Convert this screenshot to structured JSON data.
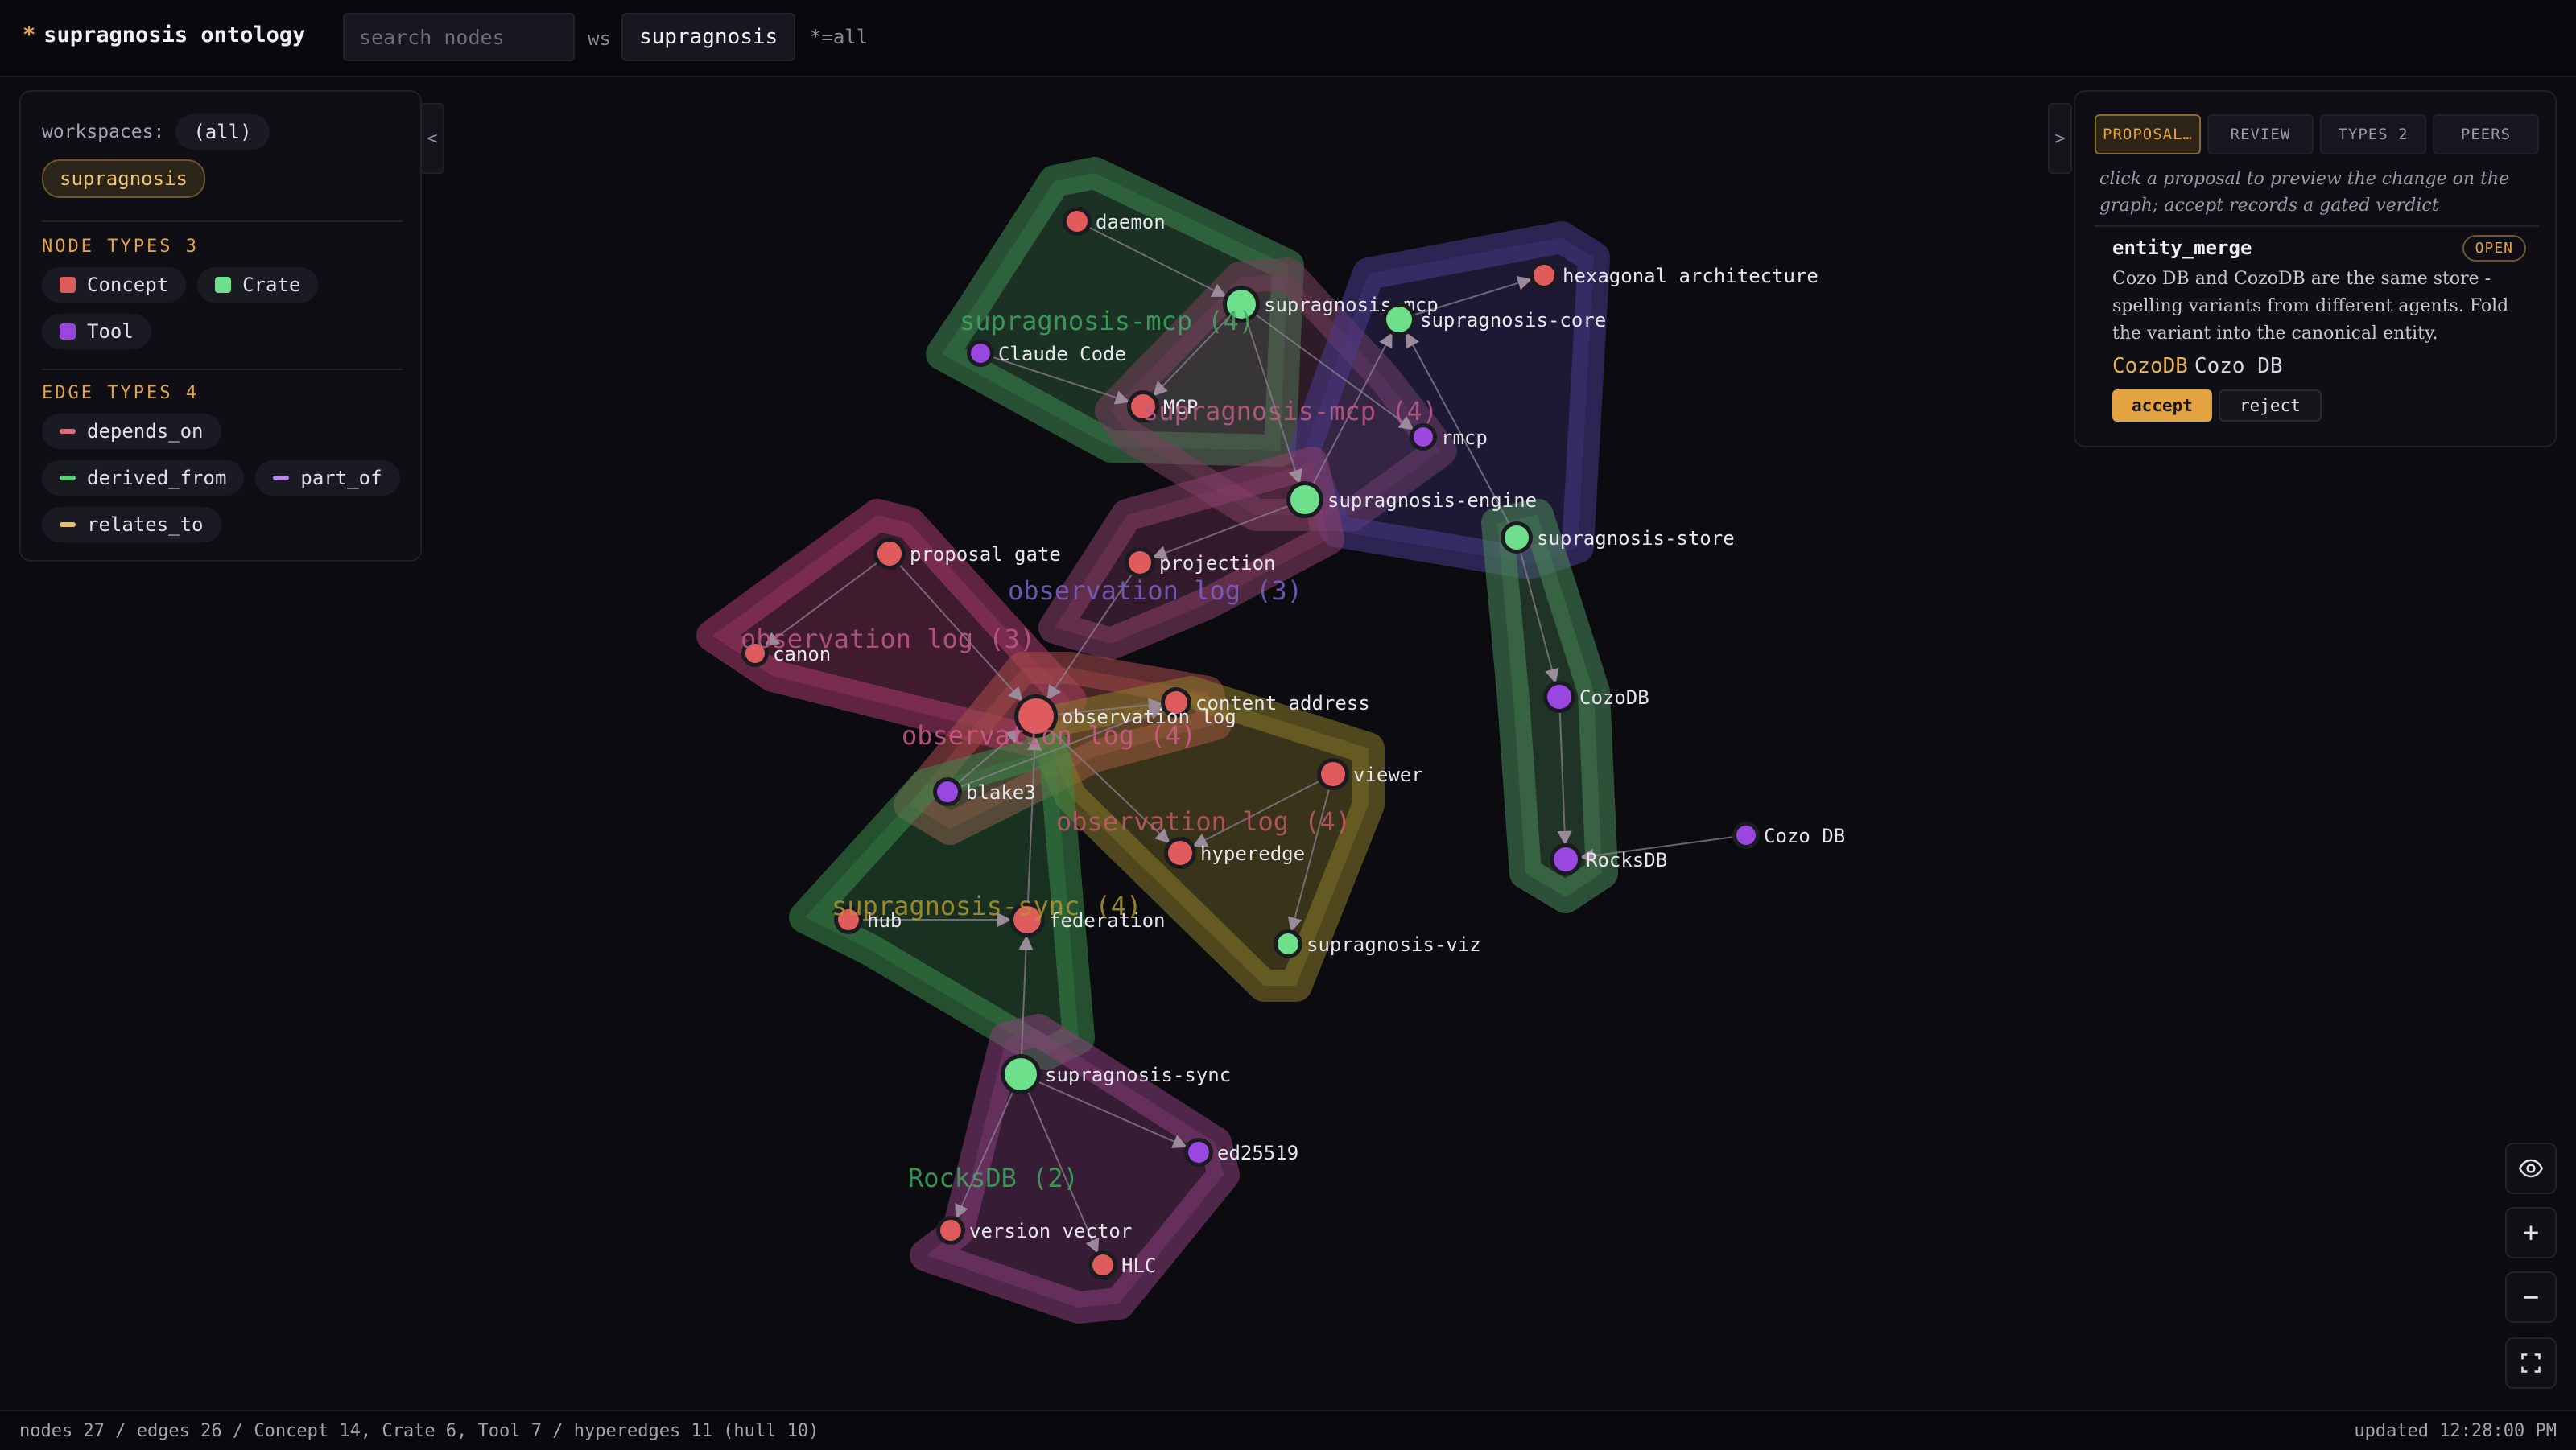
{
  "header": {
    "title": "supragnosis ontology",
    "title_mark": "*",
    "search_placeholder": "search nodes",
    "ws_label": "ws",
    "ws_value": "supragnosis",
    "ws_hint": "*=all"
  },
  "left_panel": {
    "collapse_glyph": "<",
    "workspaces_label": "workspaces:",
    "workspaces_all": "(all)",
    "workspace_active": "supragnosis",
    "node_types_title": "NODE TYPES 3",
    "node_types": [
      {
        "label": "Concept",
        "color": "#e05b5b"
      },
      {
        "label": "Crate",
        "color": "#6ee08c"
      },
      {
        "label": "Tool",
        "color": "#9a46e0"
      }
    ],
    "edge_types_title": "EDGE TYPES 4",
    "edge_types": [
      {
        "label": "depends_on",
        "color": "#e06a7a"
      },
      {
        "label": "derived_from",
        "color": "#56d07a"
      },
      {
        "label": "part_of",
        "color": "#b88ae8"
      },
      {
        "label": "relates_to",
        "color": "#e3c26a"
      }
    ]
  },
  "right_panel": {
    "collapse_glyph": ">",
    "tabs": [
      "PROPOSAL…",
      "REVIEW",
      "TYPES 2",
      "PEERS"
    ],
    "active_tab": 0,
    "hint": "click a proposal to preview the change on the graph; accept records a gated verdict",
    "proposal": {
      "kind": "entity_merge",
      "status": "OPEN",
      "description": "Cozo DB and CozoDB are the same store - spelling variants from different agents. Fold the variant into the canonical entity.",
      "canonical": "CozoDB",
      "variant": "Cozo DB",
      "accept_label": "accept",
      "reject_label": "reject"
    }
  },
  "graph": {
    "colors": {
      "Concept": "#e05b5b",
      "Crate": "#6ee08c",
      "Tool": "#9a46e0"
    },
    "nodes": [
      {
        "id": "daemon",
        "label": "daemon",
        "type": "Concept"
      },
      {
        "id": "supragnosis-mcp",
        "label": "supragnosis-mcp",
        "type": "Crate"
      },
      {
        "id": "hexagonal-architecture",
        "label": "hexagonal architecture",
        "type": "Concept"
      },
      {
        "id": "supragnosis-core",
        "label": "supragnosis-core",
        "type": "Crate"
      },
      {
        "id": "claude-code",
        "label": "Claude Code",
        "type": "Tool"
      },
      {
        "id": "mcp",
        "label": "MCP",
        "type": "Concept"
      },
      {
        "id": "rmcp",
        "label": "rmcp",
        "type": "Tool"
      },
      {
        "id": "supragnosis-engine",
        "label": "supragnosis-engine",
        "type": "Crate"
      },
      {
        "id": "supragnosis-store",
        "label": "supragnosis-store",
        "type": "Crate"
      },
      {
        "id": "proposal-gate",
        "label": "proposal gate",
        "type": "Concept"
      },
      {
        "id": "projection",
        "label": "projection",
        "type": "Concept"
      },
      {
        "id": "canon",
        "label": "canon",
        "type": "Concept"
      },
      {
        "id": "content-address",
        "label": "content address",
        "type": "Concept"
      },
      {
        "id": "observation-log",
        "label": "observation log",
        "type": "Concept"
      },
      {
        "id": "cozodb",
        "label": "CozoDB",
        "type": "Tool"
      },
      {
        "id": "viewer",
        "label": "viewer",
        "type": "Concept"
      },
      {
        "id": "blake3",
        "label": "blake3",
        "type": "Tool"
      },
      {
        "id": "hyperedge",
        "label": "hyperedge",
        "type": "Concept"
      },
      {
        "id": "rocksdb",
        "label": "RocksDB",
        "type": "Tool"
      },
      {
        "id": "cozo-db",
        "label": "Cozo DB",
        "type": "Tool"
      },
      {
        "id": "hub",
        "label": "hub",
        "type": "Concept"
      },
      {
        "id": "federation",
        "label": "federation",
        "type": "Concept"
      },
      {
        "id": "supragnosis-viz",
        "label": "supragnosis-viz",
        "type": "Crate"
      },
      {
        "id": "supragnosis-sync",
        "label": "supragnosis-sync",
        "type": "Crate"
      },
      {
        "id": "ed25519",
        "label": "ed25519",
        "type": "Tool"
      },
      {
        "id": "version-vector",
        "label": "version vector",
        "type": "Concept"
      },
      {
        "id": "hlc",
        "label": "HLC",
        "type": "Concept"
      }
    ],
    "edges": [
      [
        "daemon",
        "supragnosis-mcp"
      ],
      [
        "supragnosis-mcp",
        "mcp"
      ],
      [
        "supragnosis-mcp",
        "rmcp"
      ],
      [
        "supragnosis-mcp",
        "supragnosis-engine"
      ],
      [
        "supragnosis-core",
        "hexagonal-architecture"
      ],
      [
        "claude-code",
        "mcp"
      ],
      [
        "supragnosis-engine",
        "supragnosis-core"
      ],
      [
        "supragnosis-engine",
        "projection"
      ],
      [
        "supragnosis-store",
        "supragnosis-core"
      ],
      [
        "supragnosis-store",
        "cozodb"
      ],
      [
        "cozodb",
        "rocksdb"
      ],
      [
        "cozo-db",
        "rocksdb"
      ],
      [
        "proposal-gate",
        "canon"
      ],
      [
        "proposal-gate",
        "observation-log"
      ],
      [
        "projection",
        "observation-log"
      ],
      [
        "observation-log",
        "content-address"
      ],
      [
        "observation-log",
        "hyperedge"
      ],
      [
        "blake3",
        "content-address"
      ],
      [
        "blake3",
        "observation-log"
      ],
      [
        "viewer",
        "hyperedge"
      ],
      [
        "viewer",
        "supragnosis-viz"
      ],
      [
        "hub",
        "federation"
      ],
      [
        "federation",
        "observation-log"
      ],
      [
        "supragnosis-sync",
        "federation"
      ],
      [
        "supragnosis-sync",
        "ed25519"
      ],
      [
        "supragnosis-sync",
        "version-vector"
      ],
      [
        "supragnosis-sync",
        "hlc"
      ]
    ],
    "hulls": [
      {
        "label": "supragnosis-mcp (4)",
        "color": "#3f8a52"
      },
      {
        "label": "supragnosis-mcp (4)",
        "color": "#7a3f5c"
      },
      {
        "label": "observation log (3)",
        "color": "#4a3a8a"
      },
      {
        "label": "observation log (3)",
        "color": "#8a3f6a"
      },
      {
        "label": "observation log (3)",
        "color": "#a83a6a"
      },
      {
        "label": "observation log (4)",
        "color": "#a84a4a"
      },
      {
        "label": "observation log (4)",
        "color": "#8a7a2a"
      },
      {
        "label": "supragnosis-sync (4)",
        "color": "#3a8a4a"
      },
      {
        "label": "RocksDB (2)",
        "color": "#8a3f7a"
      },
      {
        "label": "",
        "color": "#4a8a5a"
      }
    ]
  },
  "controls": {
    "visibility": "eye-icon",
    "zoom_in": "+",
    "zoom_out": "−",
    "fit": "fit-screen-icon"
  },
  "status": {
    "stats": "nodes 27 / edges 26 / Concept 14, Crate 6, Tool 7 / hyperedges 11 (hull 10)",
    "updated": "updated 12:28:00 PM"
  }
}
